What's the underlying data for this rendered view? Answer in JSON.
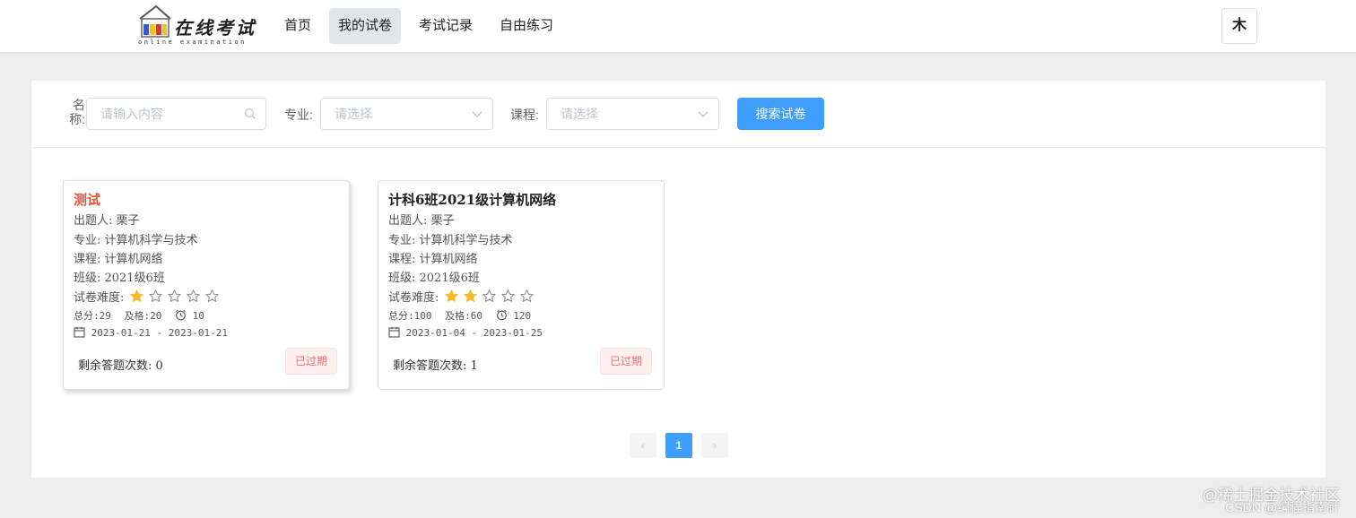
{
  "logo": {
    "title": "在线考试",
    "subtitle": "online examination"
  },
  "nav": [
    {
      "label": "首页",
      "active": false
    },
    {
      "label": "我的试卷",
      "active": true
    },
    {
      "label": "考试记录",
      "active": false
    },
    {
      "label": "自由练习",
      "active": false
    }
  ],
  "user": {
    "avatar_char": "木"
  },
  "search": {
    "name_label": "名称:",
    "name_placeholder": "请输入内容",
    "major_label": "专业:",
    "major_placeholder": "请选择",
    "course_label": "课程:",
    "course_placeholder": "请选择",
    "button": "搜索试卷"
  },
  "papers": [
    {
      "title": "测试",
      "author": "出题人: 栗子",
      "major": "专业: 计算机科学与技术",
      "course": "课程: 计算机网络",
      "class": "班级: 2021级6班",
      "difficulty_label": "试卷难度:",
      "difficulty": 1,
      "difficulty_max": 5,
      "total": "总分:29",
      "pass": "及格:20",
      "duration": "10",
      "date_range": "2023-01-21 - 2023-01-21",
      "remaining": "剩余答题次数: 0",
      "status": "已过期"
    },
    {
      "title": "计科6班2021级计算机网络",
      "author": "出题人: 栗子",
      "major": "专业: 计算机科学与技术",
      "course": "课程: 计算机网络",
      "class": "班级: 2021级6班",
      "difficulty_label": "试卷难度:",
      "difficulty": 2,
      "difficulty_max": 5,
      "total": "总分:100",
      "pass": "及格:60",
      "duration": "120",
      "date_range": "2023-01-04 - 2023-01-25",
      "remaining": "剩余答题次数: 1",
      "status": "已过期"
    }
  ],
  "pagination": {
    "prev": "‹",
    "current": "1",
    "next": "›"
  },
  "watermark": {
    "line1": "@稀土掘金技术社区",
    "line2": "CSDN @编程指南针"
  },
  "colors": {
    "primary": "#409eff",
    "danger": "#f56c6c",
    "star": "#f7ba2a",
    "title_red": "#e0533a"
  }
}
